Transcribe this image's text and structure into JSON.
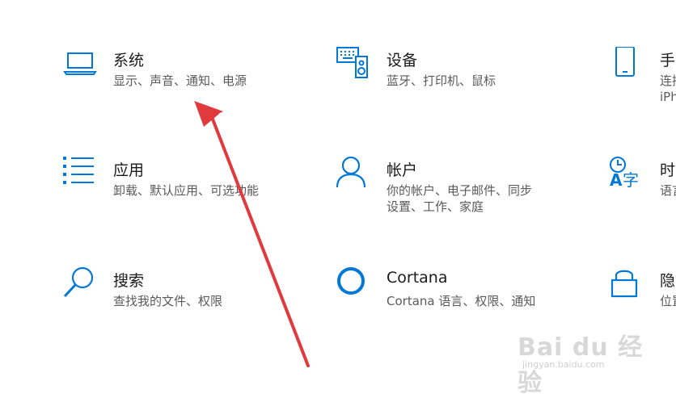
{
  "tiles": {
    "system": {
      "title": "系统",
      "desc": [
        "显示、声音、通知、电源"
      ],
      "icon": "laptop-icon"
    },
    "devices": {
      "title": "设备",
      "desc": [
        "蓝牙、打印机、鼠标"
      ],
      "icon": "keyboard-speaker-icon"
    },
    "phone": {
      "title": "手",
      "desc": [
        "连接",
        "iPh"
      ],
      "icon": "phone-icon"
    },
    "apps": {
      "title": "应用",
      "desc": [
        "卸载、默认应用、可选功能"
      ],
      "icon": "apps-list-icon"
    },
    "accounts": {
      "title": "帐户",
      "desc": [
        "你的帐户、电子邮件、同步",
        "设置、工作、家庭"
      ],
      "icon": "person-icon"
    },
    "time": {
      "title": "时",
      "desc": [
        "语言"
      ],
      "icon": "time-language-icon"
    },
    "search": {
      "title": "搜索",
      "desc": [
        "查找我的文件、权限"
      ],
      "icon": "search-icon"
    },
    "cortana": {
      "title": "Cortana",
      "desc": [
        "Cortana 语言、权限、通知"
      ],
      "icon": "cortana-icon"
    },
    "privacy": {
      "title": "隐",
      "desc": [
        "位置"
      ],
      "icon": "lock-icon"
    }
  },
  "colors": {
    "accent": "#0078d7",
    "arrow": "#e03a3e",
    "title": "#1a1a1a",
    "desc": "#5a5a5a"
  },
  "watermark": {
    "main": "Bai du 经验",
    "sub": "jingyan.baidu.com"
  }
}
